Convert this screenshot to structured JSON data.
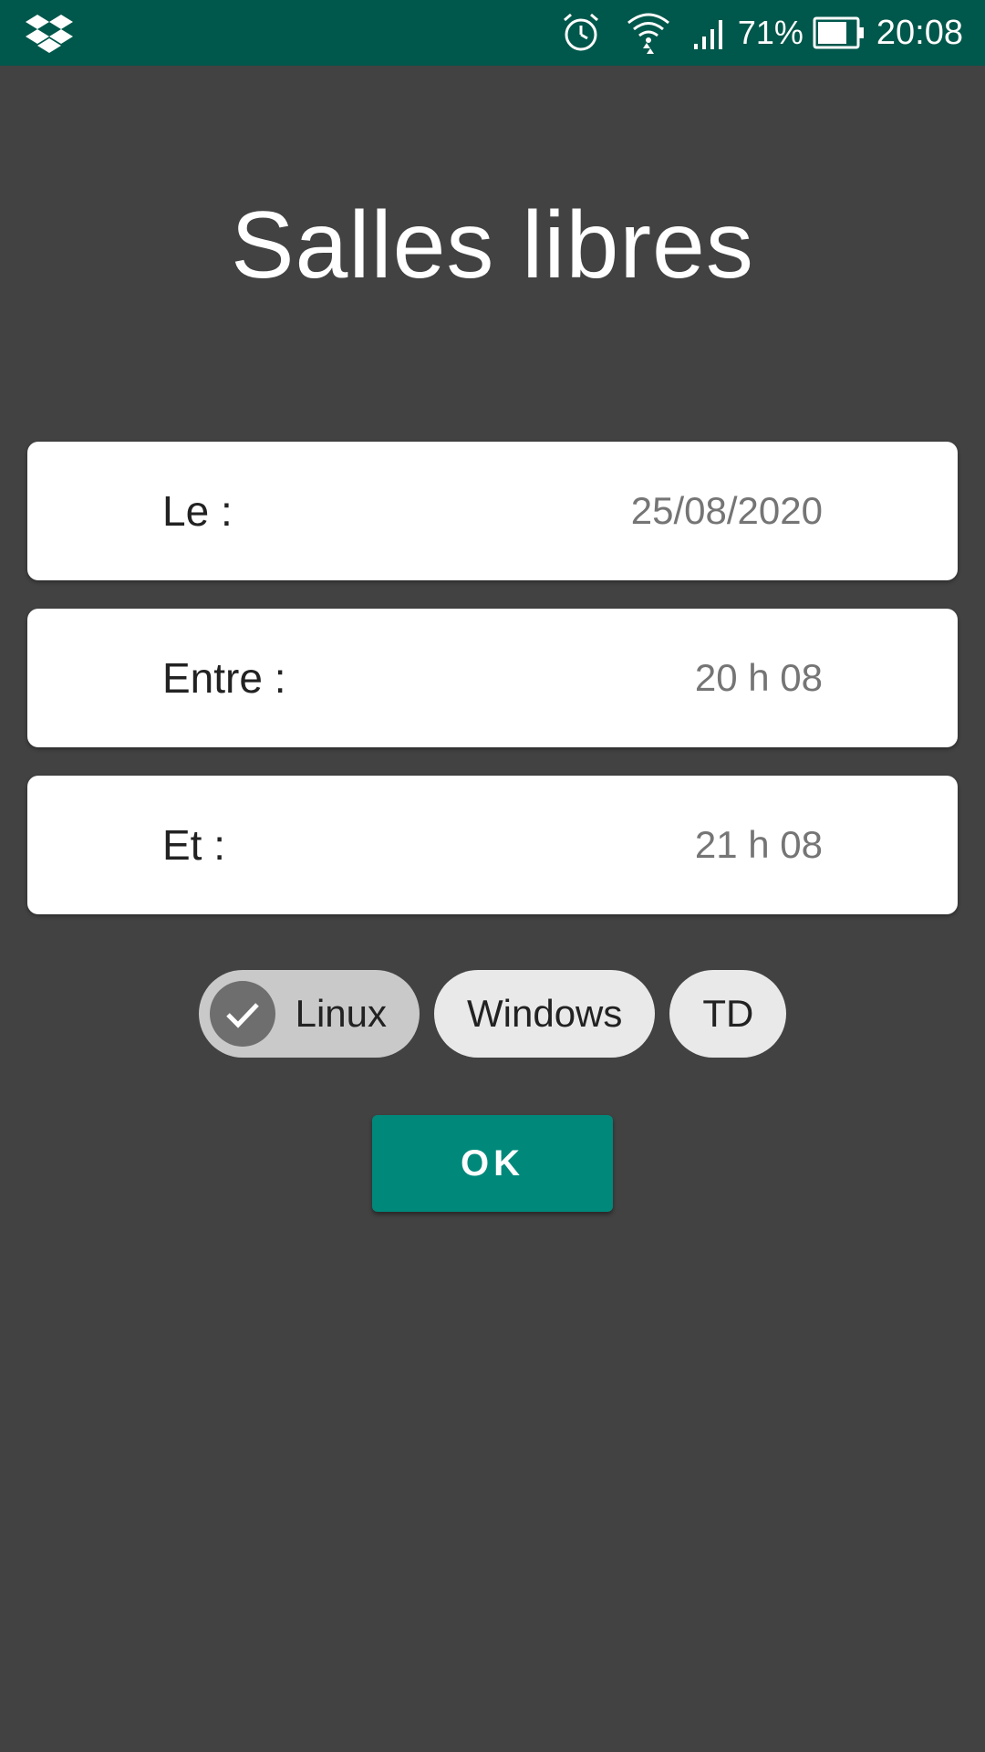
{
  "status_bar": {
    "app_icon": "dropbox-icon",
    "battery_percent": "71%",
    "time": "20:08",
    "icons": [
      "alarm-icon",
      "wifi-icon",
      "signal-icon",
      "battery-icon"
    ]
  },
  "title": "Salles libres",
  "fields": {
    "date": {
      "label": "Le :",
      "value": "25/08/2020"
    },
    "start": {
      "label": "Entre :",
      "value": "20 h 08"
    },
    "end": {
      "label": "Et :",
      "value": "21 h 08"
    }
  },
  "filters": [
    {
      "label": "Linux",
      "selected": true
    },
    {
      "label": "Windows",
      "selected": false
    },
    {
      "label": "TD",
      "selected": false
    }
  ],
  "ok_label": "OK",
  "colors": {
    "status_bar": "#00574b",
    "background": "#424242",
    "accent": "#00897b"
  }
}
